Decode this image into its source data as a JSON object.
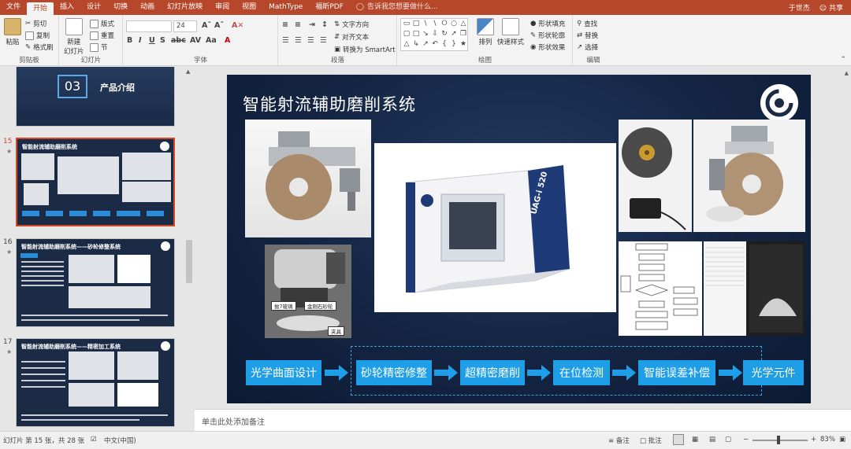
{
  "tabs": [
    {
      "label": "文件",
      "active": false
    },
    {
      "label": "开始",
      "active": true
    },
    {
      "label": "插入",
      "active": false
    },
    {
      "label": "设计",
      "active": false
    },
    {
      "label": "切换",
      "active": false
    },
    {
      "label": "动画",
      "active": false
    },
    {
      "label": "幻灯片放映",
      "active": false
    },
    {
      "label": "审阅",
      "active": false
    },
    {
      "label": "视图",
      "active": false
    },
    {
      "label": "MathType",
      "active": false
    },
    {
      "label": "福昕PDF",
      "active": false
    }
  ],
  "tell_me": "告诉我您想要做什么...",
  "user": "于世杰",
  "share": "共享",
  "ribbon": {
    "clipboard": {
      "label": "剪贴板",
      "paste": "粘贴",
      "cut": "剪切",
      "copy": "复制",
      "format_painter": "格式刷"
    },
    "slides": {
      "label": "幻灯片",
      "new_slide": "新建",
      "new_slide2": "幻灯片",
      "layout": "版式",
      "reset": "重置",
      "section": "节"
    },
    "font": {
      "label": "字体",
      "font_name": "",
      "font_size": "24"
    },
    "paragraph": {
      "label": "段落",
      "text_direction": "文字方向",
      "align_text": "对齐文本",
      "smartart": "转换为 SmartArt"
    },
    "drawing": {
      "label": "绘图",
      "arrange": "排列",
      "quick_styles": "快速样式",
      "shape_fill": "形状填充",
      "shape_outline": "形状轮廓",
      "shape_effects": "形状效果"
    },
    "editing": {
      "label": "编辑",
      "find": "查找",
      "replace": "替换",
      "select": "选择"
    }
  },
  "thumbnails": [
    {
      "num": "",
      "section_num": "03",
      "section_title": "产品介绍"
    },
    {
      "num": "15",
      "title": "智能射流辅助磨削系统",
      "selected": true
    },
    {
      "num": "16",
      "title": "智能射流辅助磨削系统——砂轮修整系统",
      "selected": false
    },
    {
      "num": "17",
      "title": "智能射流辅助磨削系统——精密加工系统",
      "selected": false
    }
  ],
  "slide": {
    "title": "智能射流辅助磨削系统",
    "machine_label": "UAG-i 520",
    "captions": [
      "抛7玻璃",
      "金刚石砂轮",
      "夹具"
    ],
    "process": [
      "光学曲面设计",
      "砂轮精密修整",
      "超精密磨削",
      "在位检测",
      "智能误差补偿",
      "光学元件"
    ]
  },
  "notes_placeholder": "单击此处添加备注",
  "status": {
    "slide_info": "幻灯片 第 15 张，共 28 张",
    "language": "中文(中国)",
    "notes_btn": "备注",
    "comments_btn": "批注",
    "zoom": "83%"
  },
  "colors": {
    "brand": "#b7472a",
    "accent": "#1d9ee6",
    "slide_bg": "#142543"
  }
}
